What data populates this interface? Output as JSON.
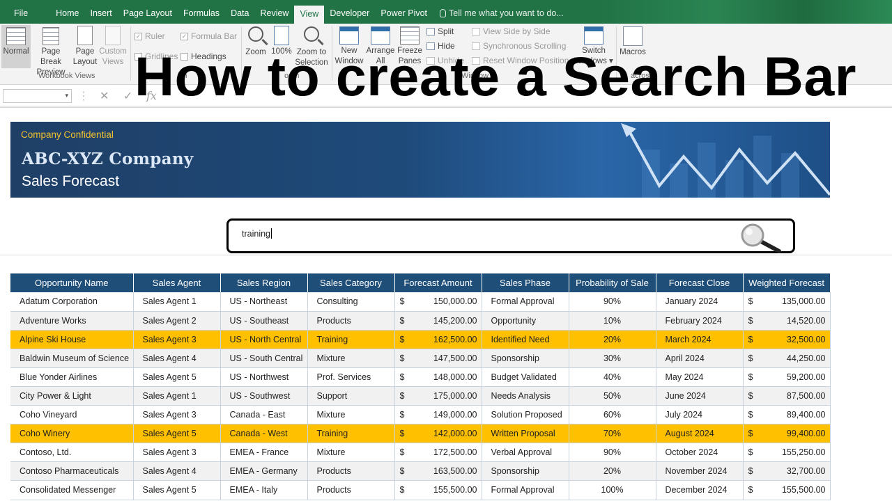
{
  "ribbon_tabs": [
    "File",
    "Home",
    "Insert",
    "Page Layout",
    "Formulas",
    "Data",
    "Review",
    "View",
    "Developer",
    "Power Pivot"
  ],
  "active_tab": "View",
  "tell_me": "Tell me what you want to do...",
  "ribbon": {
    "normal": "Normal",
    "page_break_preview": [
      "Page Break",
      "Preview"
    ],
    "page_layout": [
      "Page",
      "Layout"
    ],
    "custom_views": [
      "Custom",
      "Views"
    ],
    "workbook_views_group": "Workbook Views",
    "ruler": "Ruler",
    "formula_bar": "Formula Bar",
    "gridlines": "Gridlines",
    "headings": "Headings",
    "show_group_fragment": "Sh",
    "zoom": "Zoom",
    "zoom_100": "100%",
    "zoom_to_selection": [
      "Zoom to",
      "Selection"
    ],
    "zoom_group_fragment": "oom",
    "new_window": [
      "New",
      "Window"
    ],
    "arrange_all": [
      "Arrange",
      "All"
    ],
    "freeze_panes": [
      "Freeze",
      "Panes ▾"
    ],
    "split": "Split",
    "hide": "Hide",
    "unhide": "Unhide",
    "view_side_by_side": "View Side by Side",
    "synchronous_scrolling": "Synchronous Scrolling",
    "reset_window_position": "Reset Window Position",
    "window_group_fragment": "Window",
    "switch_windows": [
      "Switch",
      "Windows ▾"
    ],
    "macros": "Macros",
    "macros_group_fragment": "acros"
  },
  "formula_bar": {
    "cancel": "✕",
    "enter": "✓",
    "fx": "fx"
  },
  "overlay_title": "How to create a Search Bar",
  "banner": {
    "confidential": "Company Confidential",
    "company": "ABC-XYZ Company",
    "subtitle": "Sales Forecast"
  },
  "search": {
    "value": "training"
  },
  "table": {
    "headers": [
      "Opportunity Name",
      "Sales Agent",
      "Sales Region",
      "Sales Category",
      "Forecast Amount",
      "Sales Phase",
      "Probability of Sale",
      "Forecast Close",
      "Weighted Forecast"
    ],
    "currency_symbol": "$",
    "rows": [
      {
        "name": "Adatum Corporation",
        "agent": "Sales Agent 1",
        "region": "US - Northeast",
        "category": "Consulting",
        "amount": "150,000.00",
        "phase": "Formal Approval",
        "prob": "90%",
        "close": "January 2024",
        "weighted": "135,000.00",
        "highlight": false
      },
      {
        "name": "Adventure Works",
        "agent": "Sales Agent 2",
        "region": "US - Southeast",
        "category": "Products",
        "amount": "145,200.00",
        "phase": "Opportunity",
        "prob": "10%",
        "close": "February 2024",
        "weighted": "14,520.00",
        "highlight": false
      },
      {
        "name": "Alpine Ski House",
        "agent": "Sales Agent 3",
        "region": "US - North Central",
        "category": "Training",
        "amount": "162,500.00",
        "phase": "Identified Need",
        "prob": "20%",
        "close": "March 2024",
        "weighted": "32,500.00",
        "highlight": true
      },
      {
        "name": "Baldwin Museum of Science",
        "agent": "Sales Agent 4",
        "region": "US - South Central",
        "category": "Mixture",
        "amount": "147,500.00",
        "phase": "Sponsorship",
        "prob": "30%",
        "close": "April 2024",
        "weighted": "44,250.00",
        "highlight": false
      },
      {
        "name": "Blue Yonder Airlines",
        "agent": "Sales Agent 5",
        "region": "US - Northwest",
        "category": "Prof. Services",
        "amount": "148,000.00",
        "phase": "Budget Validated",
        "prob": "40%",
        "close": "May 2024",
        "weighted": "59,200.00",
        "highlight": false
      },
      {
        "name": "City Power & Light",
        "agent": "Sales Agent 1",
        "region": "US - Southwest",
        "category": "Support",
        "amount": "175,000.00",
        "phase": "Needs Analysis",
        "prob": "50%",
        "close": "June 2024",
        "weighted": "87,500.00",
        "highlight": false
      },
      {
        "name": "Coho Vineyard",
        "agent": "Sales Agent 3",
        "region": "Canada - East",
        "category": "Mixture",
        "amount": "149,000.00",
        "phase": "Solution Proposed",
        "prob": "60%",
        "close": "July 2024",
        "weighted": "89,400.00",
        "highlight": false
      },
      {
        "name": "Coho Winery",
        "agent": "Sales Agent 5",
        "region": "Canada - West",
        "category": "Training",
        "amount": "142,000.00",
        "phase": "Written Proposal",
        "prob": "70%",
        "close": "August 2024",
        "weighted": "99,400.00",
        "highlight": true
      },
      {
        "name": "Contoso, Ltd.",
        "agent": "Sales Agent 3",
        "region": "EMEA - France",
        "category": "Mixture",
        "amount": "172,500.00",
        "phase": "Verbal Approval",
        "prob": "90%",
        "close": "October 2024",
        "weighted": "155,250.00",
        "highlight": false
      },
      {
        "name": "Contoso Pharmaceuticals",
        "agent": "Sales Agent 4",
        "region": "EMEA - Germany",
        "category": "Products",
        "amount": "163,500.00",
        "phase": "Sponsorship",
        "prob": "20%",
        "close": "November 2024",
        "weighted": "32,700.00",
        "highlight": false
      },
      {
        "name": "Consolidated Messenger",
        "agent": "Sales Agent 5",
        "region": "EMEA - Italy",
        "category": "Products",
        "amount": "155,500.00",
        "phase": "Formal Approval",
        "prob": "100%",
        "close": "December 2024",
        "weighted": "155,500.00",
        "highlight": false
      }
    ]
  },
  "colors": {
    "ribbon_green": "#217346",
    "header_blue": "#1f4e79",
    "highlight": "#ffc000",
    "banner_gold": "#f2c12e"
  }
}
